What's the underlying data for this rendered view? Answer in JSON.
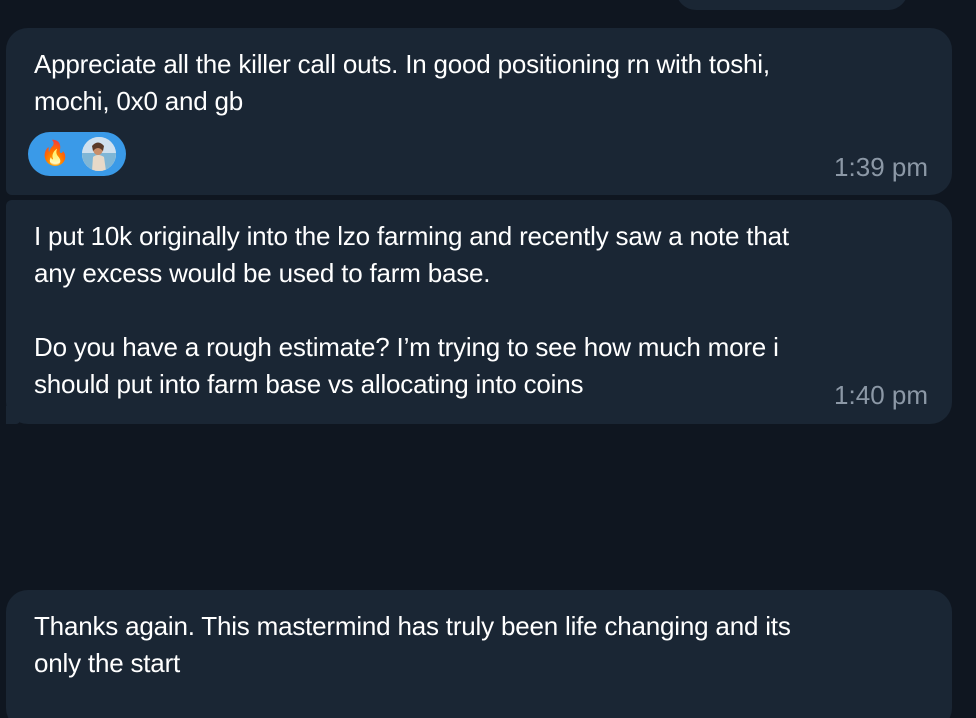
{
  "messages": [
    {
      "text": "Appreciate all the killer call outs. In good positioning rn with toshi,\nmochi, 0x0 and gb",
      "time": "1:39 pm",
      "reactions": {
        "emoji": "🔥",
        "reactor_avatar": "person-photo-avatar"
      }
    },
    {
      "text": "I put 10k originally into the lzo farming and recently saw a note that\nany excess would be used to farm base.\n\nDo you have a rough estimate? I’m trying to see how much more i\nshould put into farm base vs allocating into coins",
      "time": "1:40 pm"
    },
    {
      "text": "Thanks again. This mastermind has truly been life changing and its\nonly the start"
    }
  ],
  "colors": {
    "background": "#0f1620",
    "bubble": "#1a2634",
    "text": "#ffffff",
    "timestamp": "#8c98a6",
    "reaction_pill": "#3a9ae8"
  }
}
